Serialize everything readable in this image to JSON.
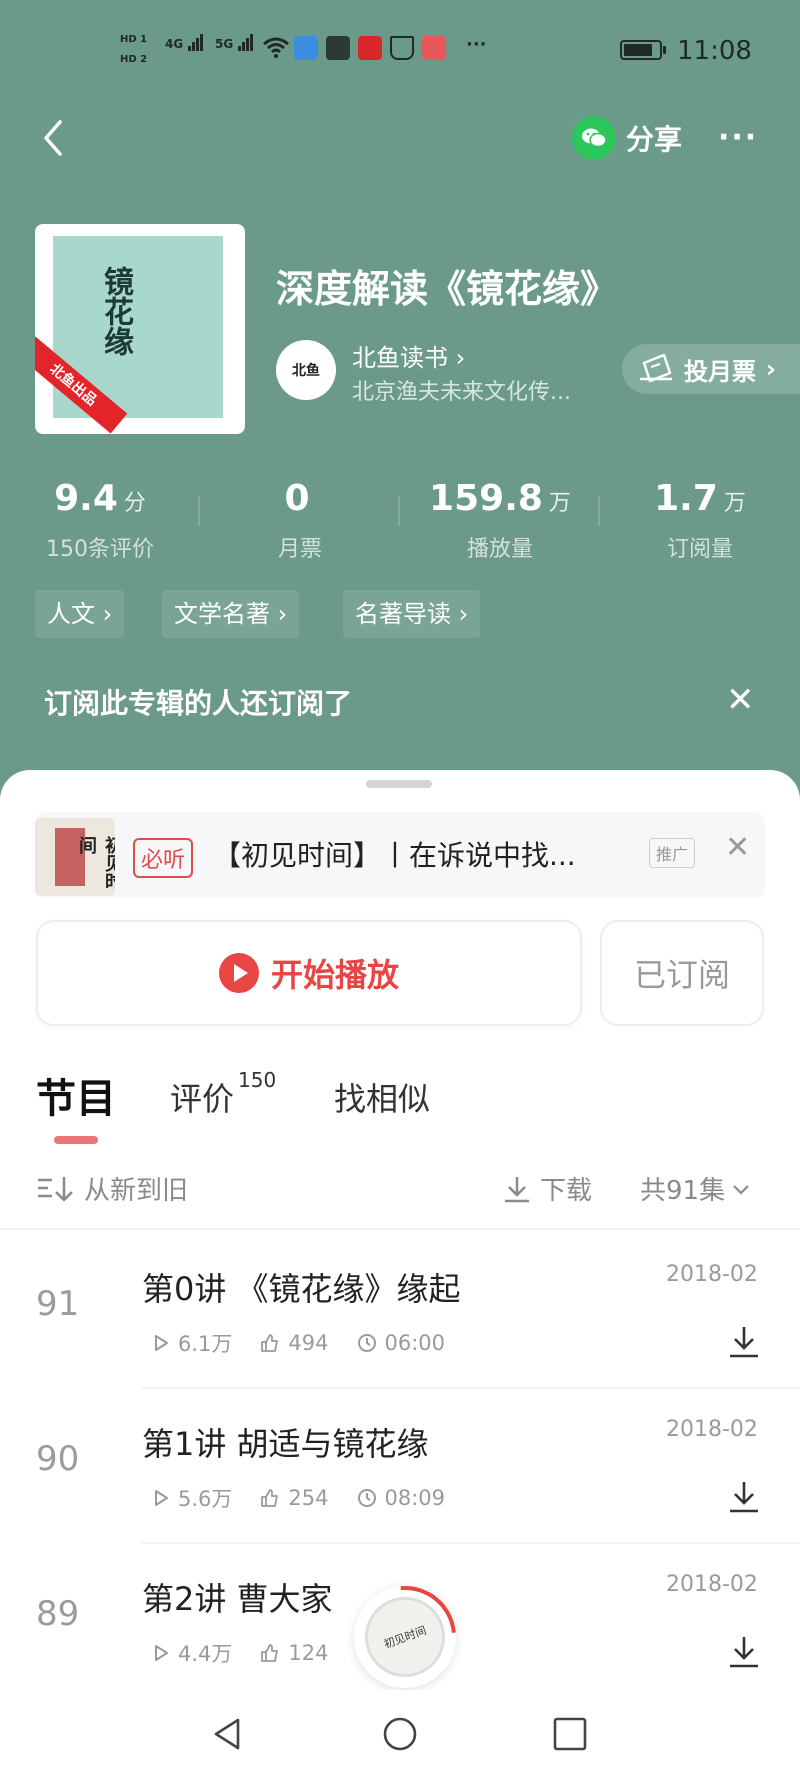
{
  "status_bar": {
    "hd1": "HD 1",
    "hd2": "HD 2",
    "net1": "4G",
    "net2": "5G",
    "dots": "···",
    "time": "11:08"
  },
  "nav": {
    "share_label": "分享",
    "more_label": "···"
  },
  "album": {
    "cover_title": "镜花缘",
    "cover_ribbon": "北鱼出品",
    "title": "深度解读《镜花缘》",
    "author_name": "北鱼读书",
    "author_chevron": "›",
    "author_avatar_text": "北鱼",
    "author_org": "北京渔夫未来文化传...",
    "vote_label": "投月票",
    "vote_chevron": "›"
  },
  "stats": [
    {
      "value": "9.4",
      "unit": "分",
      "label": "150条评价"
    },
    {
      "value": "0",
      "unit": "",
      "label": "月票"
    },
    {
      "value": "159.8",
      "unit": "万",
      "label": "播放量"
    },
    {
      "value": "1.7",
      "unit": "万",
      "label": "订阅量"
    }
  ],
  "tags": [
    "人文 ›",
    "文学名著 ›",
    "名著导读 ›"
  ],
  "recommend": {
    "title": "订阅此专辑的人还订阅了",
    "close": "✕"
  },
  "ad": {
    "badge": "必听",
    "text": "【初见时间】丨在诉说中找...",
    "promo": "推广",
    "close": "✕",
    "image_text": "初见时间"
  },
  "actions": {
    "play_label": "开始播放",
    "subscribed_label": "已订阅"
  },
  "tabs": [
    {
      "label": "节目",
      "count": ""
    },
    {
      "label": "评价",
      "count": "150"
    },
    {
      "label": "找相似",
      "count": ""
    }
  ],
  "toolbar": {
    "sort_label": "从新到旧",
    "download_label": "下载",
    "total_label": "共91集"
  },
  "episodes": [
    {
      "index": "91",
      "title": "第0讲 《镜花缘》缘起",
      "date": "2018-02",
      "plays": "6.1万",
      "likes": "494",
      "duration": "06:00"
    },
    {
      "index": "90",
      "title": "第1讲 胡适与镜花缘",
      "date": "2018-02",
      "plays": "5.6万",
      "likes": "254",
      "duration": "08:09"
    },
    {
      "index": "89",
      "title": "第2讲 曹大家",
      "date": "2018-02",
      "plays": "4.4万",
      "likes": "124",
      "duration": ""
    }
  ],
  "floating_player": {
    "label": "初见时间"
  },
  "colors": {
    "header_bg": "#6b9a8b",
    "accent_red": "#e84545",
    "wechat_green": "#2dc65a"
  },
  "icons": [
    "back-icon",
    "wechat-icon",
    "more-icon",
    "vote-ticket-icon",
    "close-icon",
    "play-icon",
    "sort-icon",
    "download-icon",
    "chevron-down-icon",
    "play-count-icon",
    "like-icon",
    "clock-icon",
    "nav-back-icon",
    "nav-home-icon",
    "nav-recent-icon"
  ]
}
